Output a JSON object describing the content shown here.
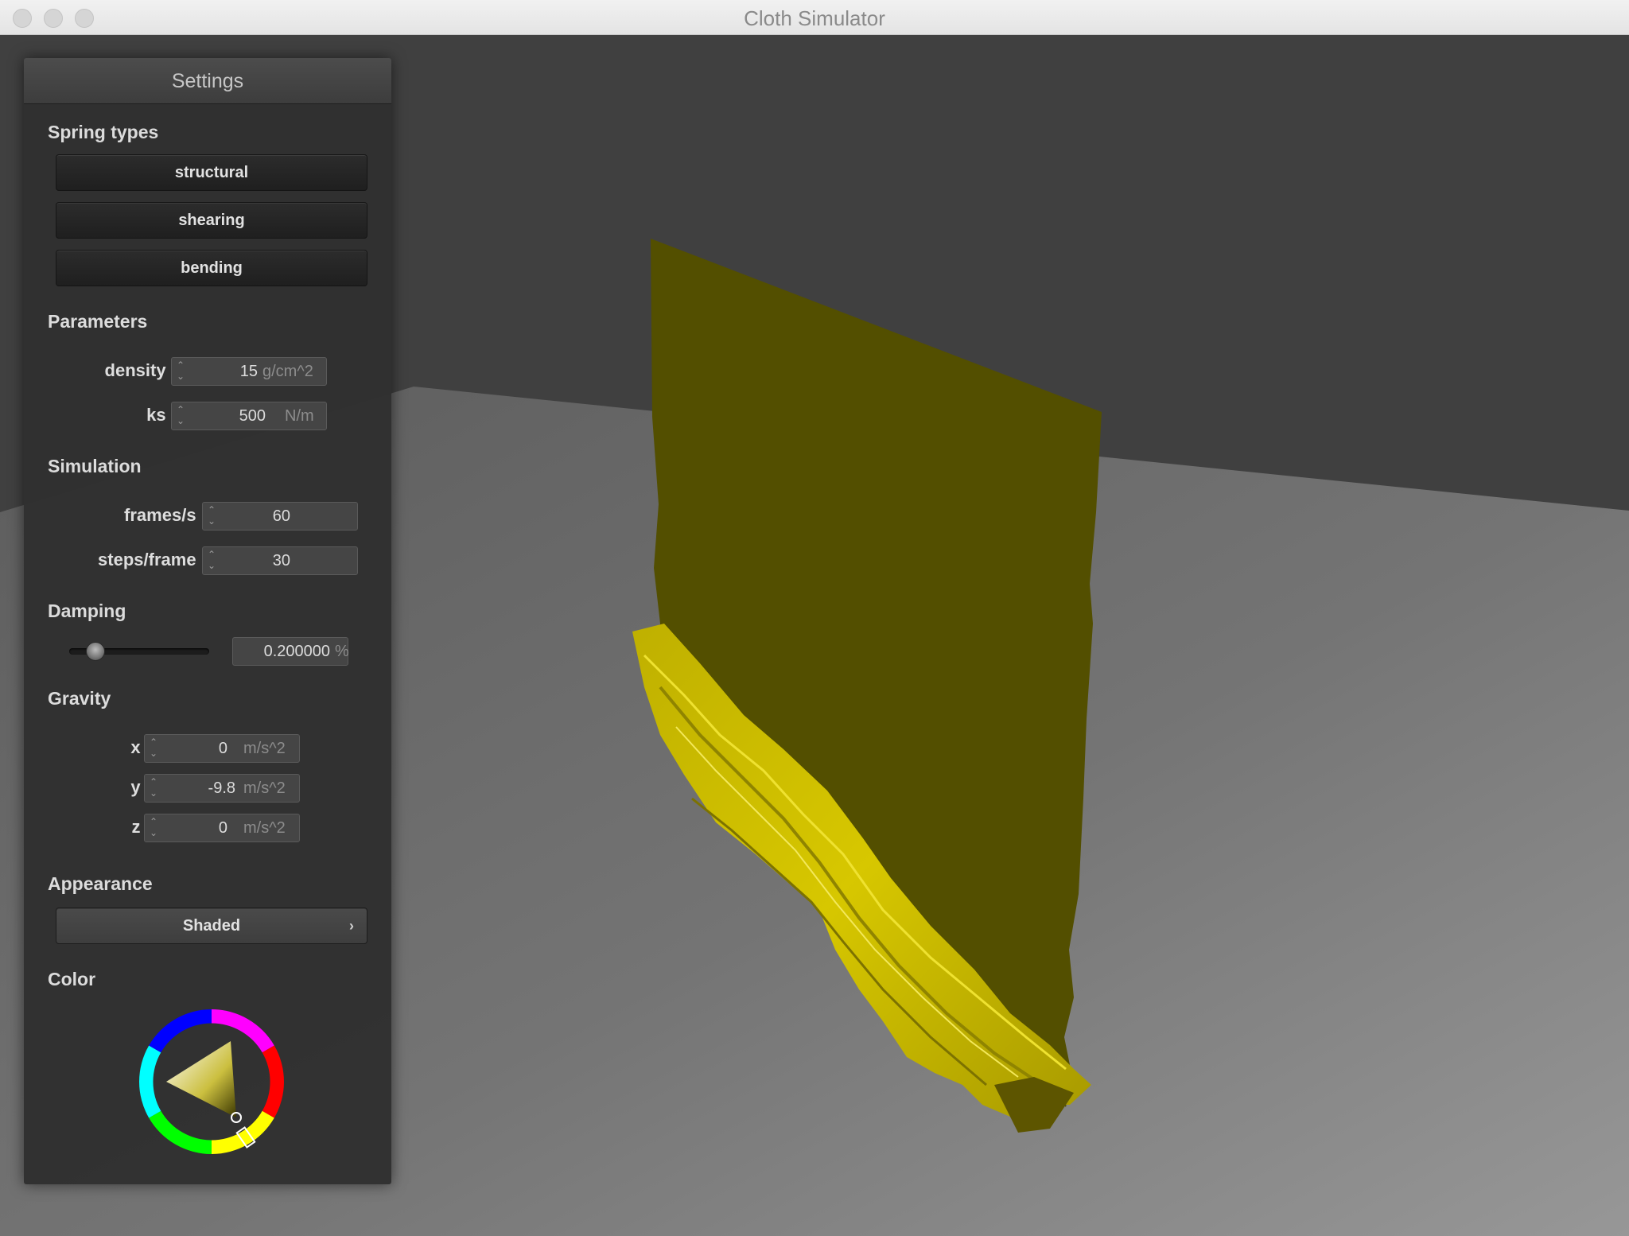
{
  "window": {
    "title": "Cloth Simulator"
  },
  "settings": {
    "title": "Settings",
    "spring_types": {
      "heading": "Spring types",
      "buttons": [
        "structural",
        "shearing",
        "bending"
      ]
    },
    "parameters": {
      "heading": "Parameters",
      "density": {
        "label": "density :",
        "value": "15",
        "unit": "g/cm^2"
      },
      "ks": {
        "label": "ks :",
        "value": "500",
        "unit": "N/m"
      }
    },
    "simulation": {
      "heading": "Simulation",
      "fps": {
        "label": "frames/s :",
        "value": "60"
      },
      "steps": {
        "label": "steps/frame :",
        "value": "30"
      }
    },
    "damping": {
      "heading": "Damping",
      "value": "0.200000",
      "unit": "%",
      "slider_fraction": 0.2
    },
    "gravity": {
      "heading": "Gravity",
      "x": {
        "label": "x :",
        "value": "0",
        "unit": "m/s^2"
      },
      "y": {
        "label": "y :",
        "value": "-9.8",
        "unit": "m/s^2"
      },
      "z": {
        "label": "z :",
        "value": "0",
        "unit": "m/s^2"
      }
    },
    "appearance": {
      "heading": "Appearance",
      "shader": "Shaded",
      "chevron": "›"
    },
    "color": {
      "heading": "Color",
      "current": "#e5d800"
    }
  },
  "scene": {
    "cloth_color": "#534f00",
    "cloth_highlight": "#d8c800",
    "floor_color": "#7a7a7a",
    "background_color": "#404040"
  }
}
